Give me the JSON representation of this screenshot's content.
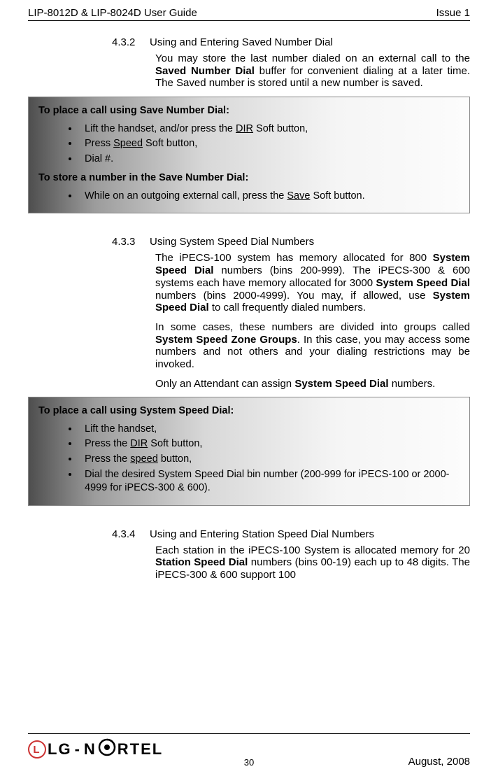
{
  "header": {
    "left": "LIP-8012D & LIP-8024D User Guide",
    "right": "Issue 1"
  },
  "sections": [
    {
      "num": "4.3.2",
      "title": "Using and Entering Saved Number Dial",
      "paras": [
        "You may store the last number dialed on an external call to the |b|Saved Number Dial|/b| buffer for convenient dialing at a later time.  The Saved number is stored until a new number is saved."
      ],
      "box": {
        "blocks": [
          {
            "type": "title",
            "text": "To place a call using Save Number Dial:"
          },
          {
            "type": "list",
            "items": [
              "Lift the handset, and/or press the |u|DIR|/u| Soft button,",
              "Press |u|Speed|/u| Soft button,",
              "Dial #."
            ]
          },
          {
            "type": "title",
            "text": "To store a number in the Save Number Dial:"
          },
          {
            "type": "list",
            "last": true,
            "items": [
              "While on an outgoing external call, press the |u|Save|/u| Soft button."
            ]
          }
        ]
      }
    },
    {
      "num": "4.3.3",
      "title": "Using System Speed Dial Numbers",
      "paras": [
        "The iPECS-100 system has memory allocated for 800 |b|System Speed Dial|/b| numbers (bins 200-999).  The iPECS-300 & 600 systems each have memory allocated for 3000 |b|System Speed Dial|/b| numbers (bins 2000-4999). You may, if allowed, use |b|System Speed Dial|/b| to call frequently dialed numbers.",
        "In some cases, these numbers are divided into groups called |b|System Speed Zone Groups|/b|.  In this case, you may access some numbers and not others and your dialing restrictions may be invoked.",
        "Only an Attendant can assign |b|System Speed Dial|/b| numbers."
      ],
      "box": {
        "blocks": [
          {
            "type": "title",
            "text": "To place a call using System Speed Dial:"
          },
          {
            "type": "list",
            "last": true,
            "items": [
              "Lift the handset,",
              "Press the |u|DIR|/u| Soft button,",
              "Press the |u|speed|/u| button,",
              "Dial the desired System Speed Dial bin number (200-999 for iPECS-100 or 2000-4999 for iPECS-300 & 600)."
            ]
          }
        ]
      }
    },
    {
      "num": "4.3.4",
      "title": "Using and Entering Station Speed Dial Numbers",
      "paras": [
        "Each station in the iPECS-100 System is allocated memory for 20 |b|Station Speed Dial|/b| numbers (bins 00-19) each up to 48 digits.  The iPECS-300 & 600 support 100"
      ]
    }
  ],
  "footer": {
    "logo_lg": "LG",
    "logo_nortel": "N   RTEL",
    "page": "30",
    "date": "August, 2008"
  }
}
